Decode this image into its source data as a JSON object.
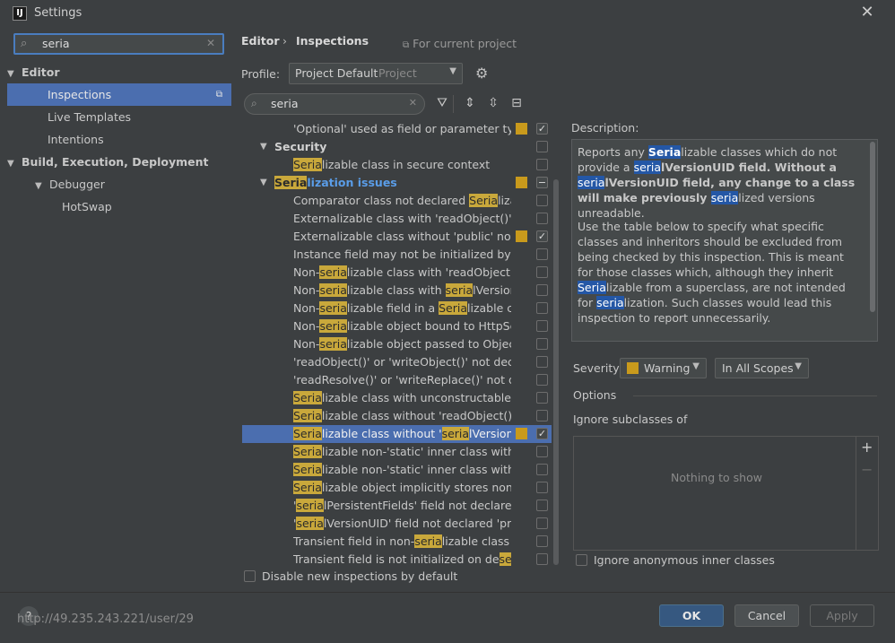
{
  "window": {
    "title": "Settings",
    "app_icon": "IJ"
  },
  "search": {
    "value": "seria",
    "clear_icon": "x-icon"
  },
  "left_tree": [
    {
      "label": "Editor",
      "level": 0,
      "bold": true,
      "expanded": true
    },
    {
      "label": "Inspections",
      "level": 1,
      "selected": true
    },
    {
      "label": "Live Templates",
      "level": 1
    },
    {
      "label": "Intentions",
      "level": 1
    },
    {
      "label": "Build, Execution, Deployment",
      "level": 0,
      "bold": true,
      "expanded": true
    },
    {
      "label": "Debugger",
      "level": 1,
      "expanded": true
    },
    {
      "label": "HotSwap",
      "level": 2
    }
  ],
  "breadcrumb": {
    "part1": "Editor",
    "sep": "›",
    "part2": "Inspections",
    "scope_note": "For current project"
  },
  "profile": {
    "label": "Profile:",
    "value": "Project Default",
    "sub": "Project"
  },
  "insp_search": {
    "value": "seria"
  },
  "inspections": [
    {
      "pre": "'Optional' used as field or parameter type",
      "sev": true,
      "check": "checked",
      "indent": 57
    },
    {
      "pre": "Security",
      "category": true,
      "expanded": true,
      "check": "unchecked",
      "indent": 36
    },
    {
      "pre": "",
      "hl": "Seria",
      "post": "lizable class in secure context",
      "check": "unchecked",
      "indent": 57
    },
    {
      "pre": "",
      "hl": "Seria",
      "post": "lization issues",
      "category": true,
      "blue": true,
      "expanded": true,
      "sev": true,
      "check": "mixed",
      "indent": 36
    },
    {
      "pre": "Comparator class not declared ",
      "hl": "Seria",
      "post": "lizable",
      "check": "unchecked",
      "indent": 57
    },
    {
      "pre": "Externalizable class with 'readObject()' or '",
      "check": "unchecked",
      "indent": 57
    },
    {
      "pre": "Externalizable class without 'public' no-arg",
      "sev": true,
      "check": "checked",
      "indent": 57
    },
    {
      "pre": "Instance field may not be initialized by 'rea",
      "check": "unchecked",
      "indent": 57
    },
    {
      "pre": "Non-",
      "hl": "seria",
      "post": "lizable class with 'readObject()' o",
      "check": "unchecked",
      "indent": 57
    },
    {
      "pre": "Non-",
      "hl": "seria",
      "post": "lizable class with ",
      "hl2": "seria",
      "post2": "lVersionU",
      "check": "unchecked",
      "indent": 57
    },
    {
      "pre": "Non-",
      "hl": "seria",
      "post": "lizable field in a ",
      "hl2": "Seria",
      "post2": "lizable clas",
      "check": "unchecked",
      "indent": 57
    },
    {
      "pre": "Non-",
      "hl": "seria",
      "post": "lizable object bound to HttpSess",
      "check": "unchecked",
      "indent": 57
    },
    {
      "pre": "Non-",
      "hl": "seria",
      "post": "lizable object passed to ObjectO",
      "check": "unchecked",
      "indent": 57
    },
    {
      "pre": "'readObject()' or 'writeObject()' not declare",
      "check": "unchecked",
      "indent": 57
    },
    {
      "pre": "'readResolve()' or 'writeReplace()' not decl",
      "check": "unchecked",
      "indent": 57
    },
    {
      "pre": "",
      "hl": "Seria",
      "post": "lizable class with unconstructable anc",
      "check": "unchecked",
      "indent": 57
    },
    {
      "pre": "",
      "hl": "Seria",
      "post": "lizable class without 'readObject()' an",
      "check": "unchecked",
      "indent": 57
    },
    {
      "pre": "",
      "hl": "Seria",
      "post": "lizable class without '",
      "hl2": "seria",
      "post2": "lVersionUID",
      "sev": true,
      "check": "checked",
      "selected": true,
      "indent": 57
    },
    {
      "pre": "",
      "hl": "Seria",
      "post": "lizable non-'static' inner class with no",
      "check": "unchecked",
      "indent": 57
    },
    {
      "pre": "",
      "hl": "Seria",
      "post": "lizable non-'static' inner class without",
      "check": "unchecked",
      "indent": 57
    },
    {
      "pre": "",
      "hl": "Seria",
      "post": "lizable object implicitly stores non-",
      "hl2": "Se",
      "post2": "",
      "check": "unchecked",
      "indent": 57
    },
    {
      "pre": "'",
      "hl": "seria",
      "post": "lPersistentFields' field not declared 'p",
      "check": "unchecked",
      "indent": 57
    },
    {
      "pre": "'",
      "hl": "seria",
      "post": "lVersionUID' field not declared 'priva",
      "check": "unchecked",
      "indent": 57
    },
    {
      "pre": "Transient field in non-",
      "hl": "seria",
      "post": "lizable class",
      "check": "unchecked",
      "indent": 57
    },
    {
      "pre": "Transient field is not initialized on de",
      "hl": "seria",
      "post": "",
      "check": "unchecked",
      "indent": 57
    }
  ],
  "disable_new": {
    "label": "Disable new inspections by default"
  },
  "description": {
    "label": "Description:",
    "p1": [
      "Reports any ",
      "Seria",
      "lizable classes which do not provide a ",
      "seria",
      "lVersionUID field. Without a ",
      "seria",
      "lVersionUID field, any change to a class will make previously ",
      "seria",
      "lized versions unreadable."
    ],
    "p2": [
      "Use the table below to specify what specific classes and inheritors should be excluded from being checked by this inspection. This is meant for those classes which, although they inherit ",
      "Seria",
      "lizable from a superclass, are not intended for ",
      "seria",
      "lization. Such classes would lead this inspection to report unnecessarily."
    ]
  },
  "severity": {
    "label": "Severity:",
    "value": "Warning",
    "color": "#c99a1c",
    "scope": "In All Scopes"
  },
  "options": {
    "label": "Options",
    "ignore_label": "Ignore subclasses of",
    "empty": "Nothing to show",
    "anon_label": "Ignore anonymous inner classes"
  },
  "buttons": {
    "ok": "OK",
    "cancel": "Cancel",
    "apply": "Apply"
  },
  "help": "?",
  "url": "http://49.235.243.221/user/29"
}
